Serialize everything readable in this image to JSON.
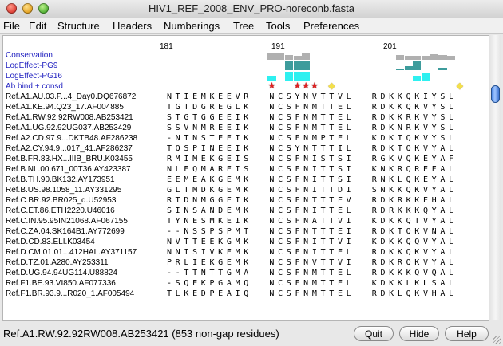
{
  "window": {
    "title": "HIV1_REF_2008_ENV_PRO-noreconb.fasta"
  },
  "menu": [
    "File",
    "Edit",
    "Structure",
    "Headers",
    "Numberings",
    "Tree",
    "Tools",
    "Preferences"
  ],
  "ruler": [
    "181",
    "191",
    "201"
  ],
  "annotations": [
    {
      "name": "Conservation",
      "heights": [
        0,
        0,
        0,
        0,
        0,
        0,
        0,
        0,
        0,
        0,
        0,
        0,
        9,
        9,
        6,
        5,
        9,
        0,
        0,
        0,
        0,
        0,
        0,
        0,
        0,
        0,
        0,
        6,
        5,
        5,
        5,
        7,
        6,
        5,
        0
      ],
      "color": "#b0b0b0"
    },
    {
      "name": "LogEffect-PG9",
      "heights": [
        0,
        0,
        0,
        0,
        0,
        0,
        0,
        0,
        0,
        0,
        0,
        0,
        0,
        0,
        11,
        11,
        11,
        0,
        0,
        0,
        0,
        0,
        0,
        0,
        0,
        0,
        0,
        2,
        5,
        11,
        0,
        0,
        3,
        0,
        0
      ],
      "color": "#3d9c9c"
    },
    {
      "name": "LogEffect-PG16",
      "heights": [
        0,
        0,
        0,
        0,
        0,
        0,
        0,
        0,
        0,
        0,
        0,
        0,
        6,
        0,
        11,
        11,
        11,
        0,
        0,
        0,
        0,
        0,
        0,
        0,
        0,
        0,
        0,
        0,
        0,
        6,
        9,
        0,
        0,
        0,
        0
      ],
      "color": "#2ef0f0"
    },
    {
      "name": "Ab bind + consd",
      "marks": [
        {
          "index": 12,
          "type": "star-red"
        },
        {
          "index": 15,
          "type": "star-red"
        },
        {
          "index": 16,
          "type": "star-red"
        },
        {
          "index": 17,
          "type": "star-red"
        },
        {
          "index": 19,
          "type": "diamond-yellow"
        },
        {
          "index": 34,
          "type": "diamond-yellow"
        }
      ]
    }
  ],
  "sequences": [
    {
      "name": "Ref.A1.AU.03.P...4_Day0.DQ676872",
      "seq": "NTIEMKEEVR  NCSYNVTTVL  RDKKQKIYSL"
    },
    {
      "name": "Ref.A1.KE.94.Q23_17.AF004885",
      "seq": "TGTDGREGLK  NCSFNMTTEL  RDKKQKVYSL"
    },
    {
      "name": "Ref.A1.RW.92.92RW008.AB253421",
      "seq": "STGTGGEEIK  NCSFNMTTEL  RDKKRKVYSL"
    },
    {
      "name": "Ref.A1.UG.92.92UG037.AB253429",
      "seq": "SSVNMREEIK  NCSFNMTTEL  RDKNRKVYSL"
    },
    {
      "name": "Ref.A2.CD.97.9...DKTB48.AF286238",
      "seq": "-NTNSTEEIK  NCSFNMPTEL  KDKTQKVYSL"
    },
    {
      "name": "Ref.A2.CY.94.9...017_41.AF286237",
      "seq": "TQSPINEEIK  NCSYNTTTIL  RDKTQKVYAL"
    },
    {
      "name": "Ref.B.FR.83.HX...IIIB_BRU.K03455",
      "seq": "RMIMEKGEIS  NCSFNISTSI  RGKVQKEYAF"
    },
    {
      "name": "Ref.B.NL.00.671_00T36.AY423387",
      "seq": "NLEQMAREIS  NCSFNITTSI  KNKRQREFAL"
    },
    {
      "name": "Ref.B.TH.90.BK132.AY173951",
      "seq": "EEMEAKGEMK  NCSFNITTSI  RNKLQKEYAL"
    },
    {
      "name": "Ref.B.US.98.1058_11.AY331295",
      "seq": "GLTMDKGEMK  NCSFNITTDI  SNKKQKVYAL"
    },
    {
      "name": "Ref.C.BR.92.BR025_d.U52953",
      "seq": "RTDNMGGEIK  NCSFNTTTEV  RDKRKKEHAL"
    },
    {
      "name": "Ref.C.ET.86.ETH2220.U46016",
      "seq": "SINSANDEMK  NCSFNITTEL  RDRKKKQYAL"
    },
    {
      "name": "Ref.C.IN.95.95IN21068.AF067155",
      "seq": "TYNESMKEIK  NCSFNATTVI  KDKKQTVYAL"
    },
    {
      "name": "Ref.C.ZA.04.SK164B1.AY772699",
      "seq": "--NSSPSPMT  NCSFNTTTEI  RDKTQKVNAL"
    },
    {
      "name": "Ref.D.CD.83.ELI.K03454",
      "seq": "NVTTEEKGMK  NCSFNITTVI  KDKKQQVYAL"
    },
    {
      "name": "Ref.D.CM.01.01...412HAL.AY371157",
      "seq": "NNISIVKEMK  NCSFNITTEL  RDKKQKVYAL"
    },
    {
      "name": "Ref.D.TZ.01.A280.AY253311",
      "seq": "PRLIEKGEMK  NCSFNVTTVI  RDKRQKVYAL"
    },
    {
      "name": "Ref.D.UG.94.94UG114.U88824",
      "seq": "--TTNTTGMA  NCSFNMTTEL  RDKKKQVQAL"
    },
    {
      "name": "Ref.F1.BE.93.VI850.AF077336",
      "seq": "-SQEKPGAMQ  NCSFNMTTEL  KDKKLKLSAL"
    },
    {
      "name": "Ref.F1.BR.93.9...R020_1.AF005494",
      "seq": "TLKEDPEAIQ  NCSFNMTTEL  RDKLQKVHAL"
    }
  ],
  "status": {
    "text": "Ref.A1.RW.92.92RW008.AB253421 (853 non-gap residues)"
  },
  "buttons": {
    "quit": "Quit",
    "hide": "Hide",
    "help": "Help"
  }
}
